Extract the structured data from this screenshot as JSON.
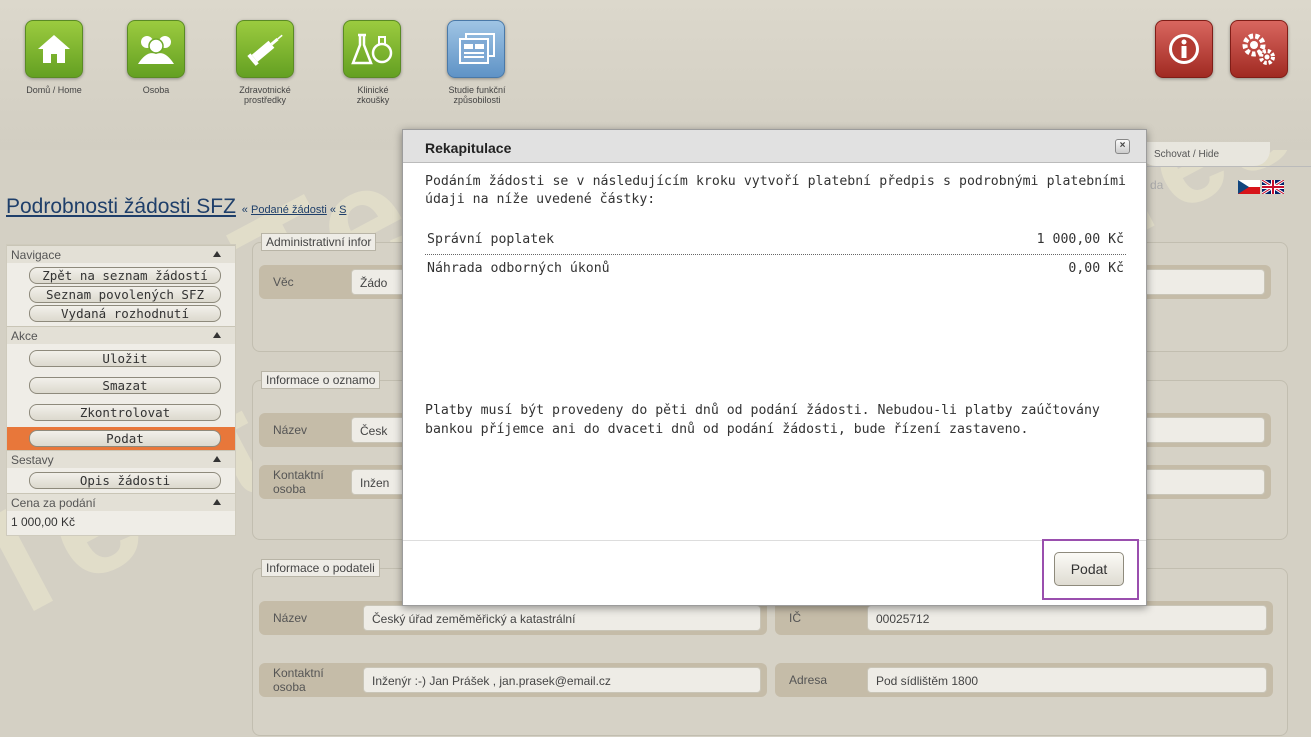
{
  "toolbar": {
    "items": [
      {
        "label": "Domů / Home",
        "icon": "home-icon"
      },
      {
        "label": "Osoba",
        "icon": "people-icon"
      },
      {
        "label": "Zdravotnické prostředky",
        "icon": "syringe-icon"
      },
      {
        "label": "Klinické zkoušky",
        "icon": "flask-icon"
      },
      {
        "label": "Studie funkční způsobilosti",
        "icon": "documents-icon"
      }
    ],
    "info_icon": "info-icon",
    "settings_icon": "gears-icon",
    "hide_label": "Schovat / Hide",
    "da_text": "da"
  },
  "watermark": "Test",
  "page": {
    "title": "Podrobnosti žádosti SFZ",
    "breadcrumb_sep": "«",
    "breadcrumb_link": "Podané žádosti",
    "breadcrumb_tail": "S"
  },
  "sidebar": {
    "sections": [
      {
        "title": "Navigace",
        "buttons": [
          "Zpět na seznam žádostí",
          "Seznam povolených SFZ",
          "Vydaná rozhodnutí"
        ]
      },
      {
        "title": "Akce",
        "buttons": [
          "Uložit",
          "Smazat",
          "Zkontrolovat",
          "Podat"
        ]
      },
      {
        "title": "Sestavy",
        "buttons": [
          "Opis žádosti"
        ]
      },
      {
        "title": "Cena za podání",
        "value": "1 000,00 Kč"
      }
    ]
  },
  "content": {
    "admin": {
      "legend": "Administrativní infor",
      "vec_label": "Věc",
      "vec_value": "Žádo"
    },
    "oznam": {
      "legend": "Informace o oznamo",
      "nazev_label": "Název",
      "nazev_value": "Česk",
      "kontakt_label": "Kontaktní osoba",
      "kontakt_value": "Inžen"
    },
    "podatel": {
      "legend": "Informace o podateli",
      "nazev_label": "Název",
      "nazev_value": "Český úřad zeměměřický a katastrální",
      "ic_label": "IČ",
      "ic_value": "00025712",
      "kontakt_label": "Kontaktní osoba",
      "kontakt_value": "Inženýr :-) Jan Prášek , jan.prasek@email.cz",
      "adresa_label": "Adresa",
      "adresa_value": "Pod sídlištěm 1800"
    }
  },
  "modal": {
    "title": "Rekapitulace",
    "close": "×",
    "intro": "Podáním žádosti se v následujícím kroku vytvoří platební předpis s podrobnými platebními údaji na níže uvedené částky:",
    "fees": [
      {
        "label": "Správní poplatek",
        "amount": "1 000,00 Kč"
      },
      {
        "label": "Náhrada odborných úkonů",
        "amount": "0,00 Kč"
      }
    ],
    "note": "Platby musí být provedeny do pěti dnů od podání žádosti. Nebudou-li platby zaúčtovány bankou příjemce ani do dvaceti dnů od podání žádosti, bude řízení zastaveno.",
    "submit_label": "Podat"
  },
  "colors": {
    "highlight": "#9a4fae",
    "active_action": "#e8773a",
    "title": "#1f3f6a"
  }
}
